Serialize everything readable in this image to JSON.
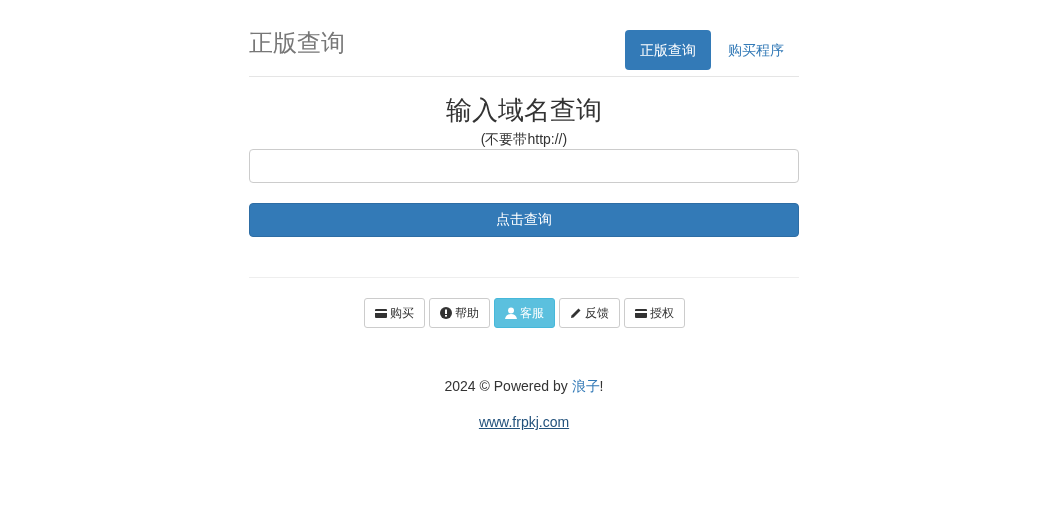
{
  "header": {
    "title": "正版查询",
    "nav": [
      {
        "label": "正版查询",
        "selected": true
      },
      {
        "label": "购买程序",
        "selected": false
      }
    ]
  },
  "form": {
    "heading": "输入域名查询",
    "hint": "(不要带http://)",
    "submit": "点击查询"
  },
  "buttons": [
    {
      "label": "购买",
      "kind": "card",
      "highlighted": false
    },
    {
      "label": "帮助",
      "kind": "alert",
      "highlighted": false
    },
    {
      "label": "客服",
      "kind": "user",
      "highlighted": true
    },
    {
      "label": "反馈",
      "kind": "pencil",
      "highlighted": false
    },
    {
      "label": "授权",
      "kind": "card",
      "highlighted": false
    }
  ],
  "footer": {
    "text": "2024 © Powered by ",
    "link": "浪子",
    "suffix": "!",
    "site": "www.frpkj.com"
  }
}
